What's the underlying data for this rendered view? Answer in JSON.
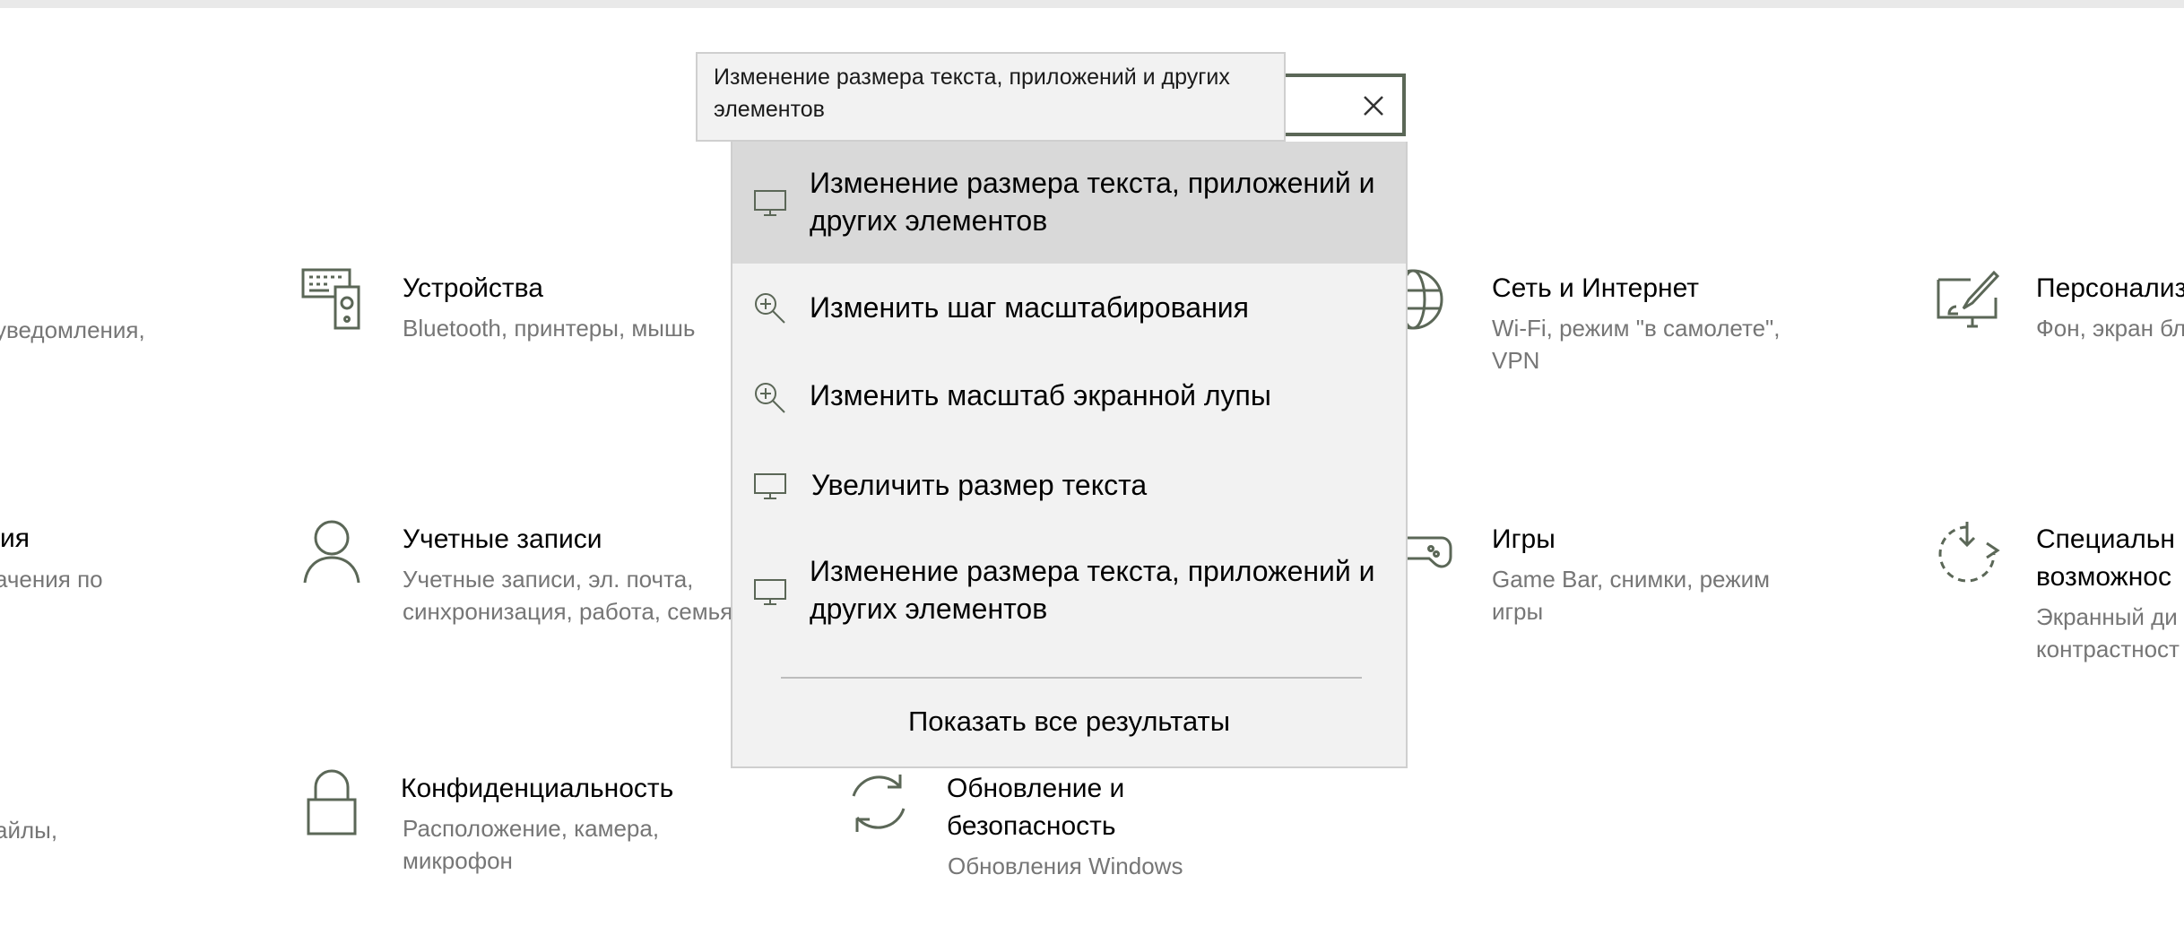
{
  "colors": {
    "icon": "#5b6757",
    "desc": "#767676",
    "popup_bg": "#f2f2f2",
    "selected_bg": "#d9d9d9"
  },
  "search": {
    "tooltip": "Изменение размера текста, приложений и других элементов",
    "clear_icon": "close-icon"
  },
  "suggestions": [
    {
      "icon": "monitor-icon",
      "label": "Изменение размера текста, приложений и других элементов",
      "selected": true
    },
    {
      "icon": "zoom-in-icon",
      "label": "Изменить шаг масштабирования"
    },
    {
      "icon": "zoom-in-icon",
      "label": "Изменить масштаб экранной лупы"
    },
    {
      "icon": "monitor-icon",
      "label": "Увеличить размер текста"
    },
    {
      "icon": "monitor-icon",
      "label": "Изменение размера текста, приложений и других элементов"
    }
  ],
  "show_all": "Показать все результаты",
  "tiles": {
    "system": {
      "desc": "уведомления,"
    },
    "devices": {
      "icon": "keyboard-speaker-icon",
      "title": "Устройства",
      "desc": "Bluetooth, принтеры, мышь"
    },
    "network": {
      "icon": "globe-icon",
      "title": "Сеть и Интернет",
      "desc": "Wi-Fi, режим \"в самолете\", VPN"
    },
    "personalization": {
      "icon": "paint-monitor-icon",
      "title": "Персонализ",
      "desc": "Фон, экран бл"
    },
    "apps": {
      "title": "ия",
      "desc": "ачения по"
    },
    "accounts": {
      "icon": "person-icon",
      "title": "Учетные записи",
      "desc": "Учетные записи, эл. почта, синхронизация, работа, семья"
    },
    "gaming": {
      "icon": "gamepad-icon",
      "title": "Игры",
      "desc": "Game Bar, снимки, режим игры"
    },
    "ease": {
      "icon": "ease-of-access-icon",
      "title": "Специальн возможнос",
      "desc": "Экранный ди контрастност"
    },
    "search_tile": {
      "desc": "айлы,"
    },
    "privacy": {
      "icon": "lock-icon",
      "title": "Конфиденциальность",
      "desc": "Расположение, камера, микрофон"
    },
    "update": {
      "icon": "sync-icon",
      "title": "Обновление и безопасность",
      "desc": "Обновления Windows"
    }
  }
}
